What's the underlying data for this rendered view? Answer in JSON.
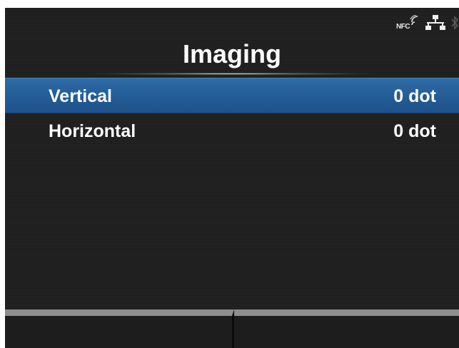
{
  "status": {
    "nfc_label": "NFC",
    "icons": [
      "nfc-icon",
      "network-icon",
      "bluetooth-icon"
    ]
  },
  "header": {
    "title": "Imaging"
  },
  "menu": {
    "items": [
      {
        "label": "Vertical",
        "value": "0 dot",
        "selected": true
      },
      {
        "label": "Horizontal",
        "value": "0 dot",
        "selected": false
      }
    ]
  },
  "softkeys": {
    "left_label": "",
    "right_label": ""
  },
  "colors": {
    "background": "#1f1f1f",
    "selection": "#245d97",
    "softkey_bar": "#8e8e8e",
    "text": "#ffffff"
  }
}
